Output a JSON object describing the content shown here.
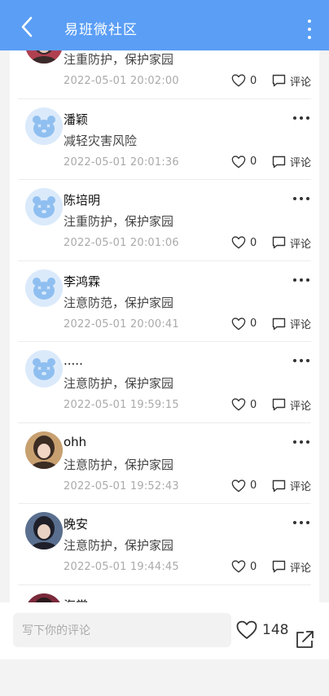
{
  "header": {
    "title": "易班微社区",
    "back_icon": "chevron-left-icon",
    "menu_icon": "more-vertical-icon"
  },
  "comments": [
    {
      "name": "",
      "content": "注重防护，保护家园",
      "time": "2022-05-01 20:02:00",
      "likes": "0",
      "comment_label": "评论",
      "avatar": "photo"
    },
    {
      "name": "潘颖",
      "content": "减轻灾害风险",
      "time": "2022-05-01 20:01:36",
      "likes": "0",
      "comment_label": "评论",
      "avatar": "bear"
    },
    {
      "name": "陈培明",
      "content": "注重防护，保护家园",
      "time": "2022-05-01 20:01:06",
      "likes": "0",
      "comment_label": "评论",
      "avatar": "bear"
    },
    {
      "name": "李鸿霖",
      "content": "注意防范，保护家园",
      "time": "2022-05-01 20:00:41",
      "likes": "0",
      "comment_label": "评论",
      "avatar": "bear"
    },
    {
      "name": ".....",
      "content": "注意防护，保护家园",
      "time": "2022-05-01 19:59:15",
      "likes": "0",
      "comment_label": "评论",
      "avatar": "bear"
    },
    {
      "name": "ohh",
      "content": "注意防护，保护家园",
      "time": "2022-05-01 19:52:43",
      "likes": "0",
      "comment_label": "评论",
      "avatar": "photo"
    },
    {
      "name": "晚安",
      "content": "注意防护，保护家园",
      "time": "2022-05-01 19:44:45",
      "likes": "0",
      "comment_label": "评论",
      "avatar": "photo"
    },
    {
      "name": "海棠",
      "content": "",
      "time": "",
      "likes": "",
      "comment_label": "",
      "avatar": "photo"
    }
  ],
  "footer": {
    "input_placeholder": "写下你的评论",
    "like_count": "148",
    "like_icon": "heart-icon",
    "share_icon": "share-icon"
  },
  "colors": {
    "header_bg": "#5a9ef5",
    "bear_avatar_bg": "#dbeafb",
    "bear_avatar_fg": "#8fbff0"
  }
}
